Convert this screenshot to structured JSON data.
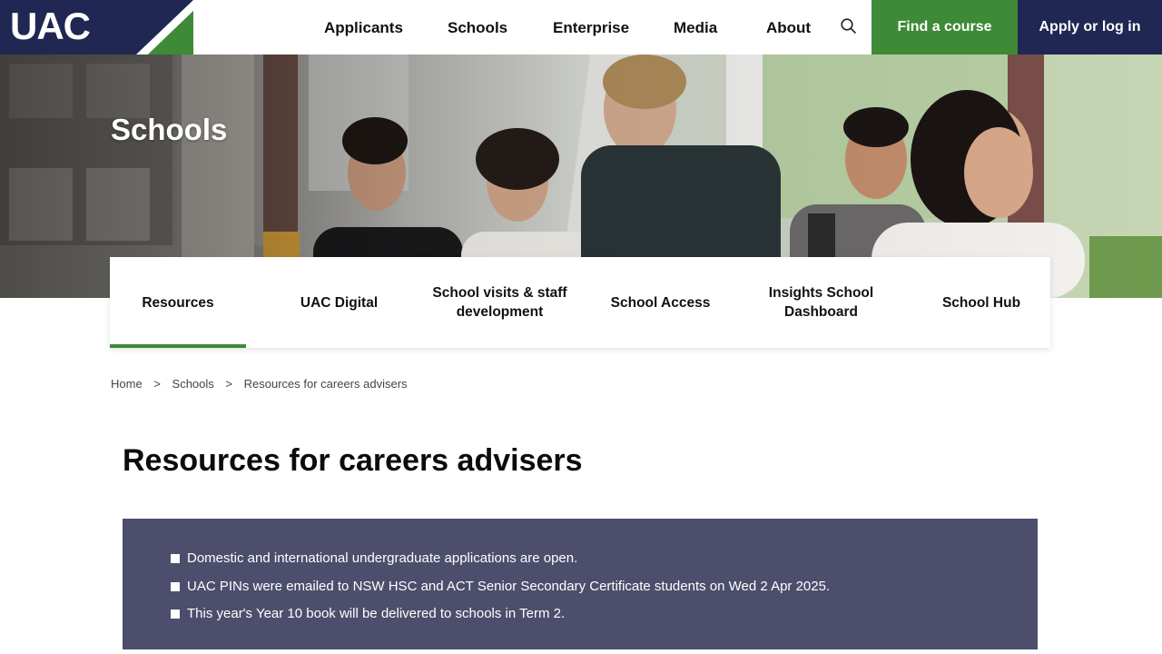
{
  "header": {
    "logo_text": "UAC",
    "nav": [
      "Applicants",
      "Schools",
      "Enterprise",
      "Media",
      "About"
    ],
    "search_icon": "search-icon",
    "find_course_label": "Find a course",
    "apply_label": "Apply or log in"
  },
  "hero": {
    "title": "Schools"
  },
  "subnav": {
    "items": [
      {
        "label": "Resources",
        "active": true
      },
      {
        "label": "UAC Digital"
      },
      {
        "label": "School visits & staff development"
      },
      {
        "label": "School Access"
      },
      {
        "label": "Insights School Dashboard"
      },
      {
        "label": "School Hub"
      }
    ]
  },
  "breadcrumb": {
    "items": [
      "Home",
      "Schools",
      "Resources for careers advisers"
    ],
    "separator": ">"
  },
  "page": {
    "title": "Resources for careers advisers"
  },
  "notice": {
    "items": [
      "Domestic and international undergraduate applications are open.",
      "UAC PINs were emailed to NSW HSC and ACT Senior Secondary Certificate students on Wed 2 Apr 2025.",
      "This year's Year 10 book will be delivered to schools in Term 2."
    ]
  },
  "colors": {
    "brand_navy": "#1f2752",
    "brand_green": "#3e8a36",
    "notice_bg": "#4c4e6c"
  }
}
